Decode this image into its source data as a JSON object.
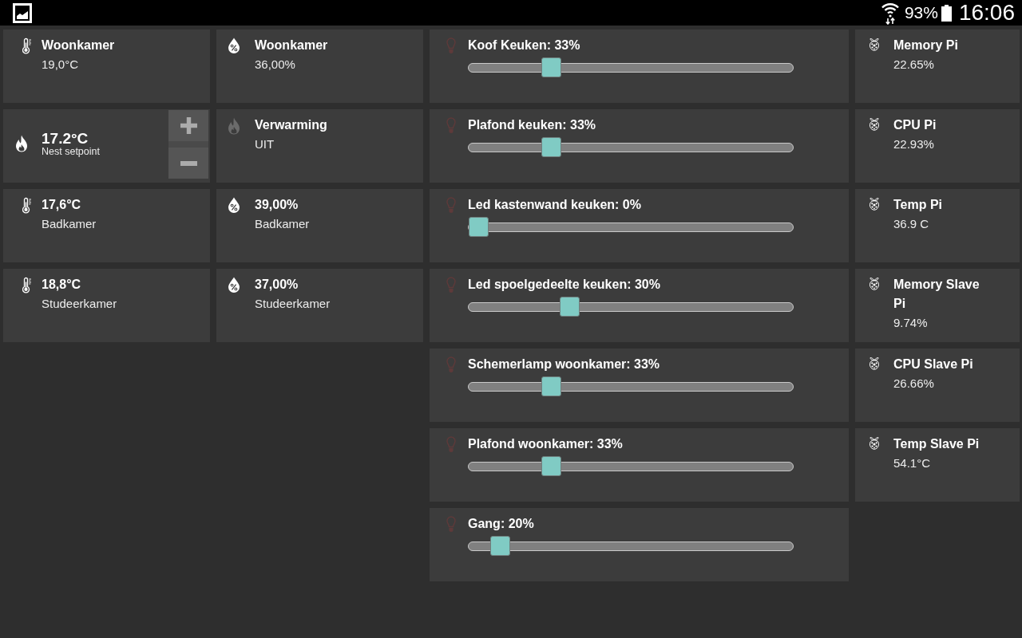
{
  "status_bar": {
    "battery": "93%",
    "time": "16:06"
  },
  "columns": [
    {
      "tiles": [
        {
          "kind": "temperature",
          "title": "Woonkamer",
          "text": "19,0°C"
        },
        {
          "kind": "setpoint",
          "value": "17.2°C",
          "label": "Nest setpoint"
        },
        {
          "kind": "temperature",
          "title": "17,6°C",
          "text": "Badkamer"
        },
        {
          "kind": "temperature",
          "title": "18,8°C",
          "text": "Studeerkamer"
        }
      ]
    },
    {
      "tiles": [
        {
          "kind": "humidity",
          "title": "Woonkamer",
          "text": "36,00%"
        },
        {
          "kind": "heating",
          "title": "Verwarming",
          "text": "UIT",
          "on": false
        },
        {
          "kind": "humidity",
          "title": "39,00%",
          "text": "Badkamer"
        },
        {
          "kind": "humidity",
          "title": "37,00%",
          "text": "Studeerkamer"
        }
      ]
    },
    {
      "tiles": [
        {
          "kind": "dimmer",
          "label": "Koof Keuken: 33%",
          "level": 0.24
        },
        {
          "kind": "dimmer",
          "label": "Plafond keuken: 33%",
          "level": 0.24
        },
        {
          "kind": "dimmer",
          "label": "Led kastenwand keuken: 0%",
          "level": 0
        },
        {
          "kind": "dimmer",
          "label": "Led spoelgedeelte keuken: 30%",
          "level": 0.3
        },
        {
          "kind": "dimmer",
          "label": "Schemerlamp woonkamer: 33%",
          "level": 0.24
        },
        {
          "kind": "dimmer",
          "label": "Plafond woonkamer: 33%",
          "level": 0.24
        },
        {
          "kind": "dimmer",
          "label": "Gang: 20%",
          "level": 0.07
        }
      ]
    },
    {
      "tiles": [
        {
          "kind": "pi",
          "title": "Memory Pi",
          "text": "22.65%"
        },
        {
          "kind": "pi",
          "title": "CPU Pi",
          "text": "22.93%"
        },
        {
          "kind": "pi",
          "title": "Temp Pi",
          "text": "36.9 C"
        },
        {
          "kind": "pi",
          "title": "Memory Slave Pi",
          "text": "9.74%"
        },
        {
          "kind": "pi",
          "title": "CPU Slave Pi",
          "text": "26.66%"
        },
        {
          "kind": "pi",
          "title": "Temp Slave Pi",
          "text": "54.1°C"
        }
      ]
    }
  ]
}
